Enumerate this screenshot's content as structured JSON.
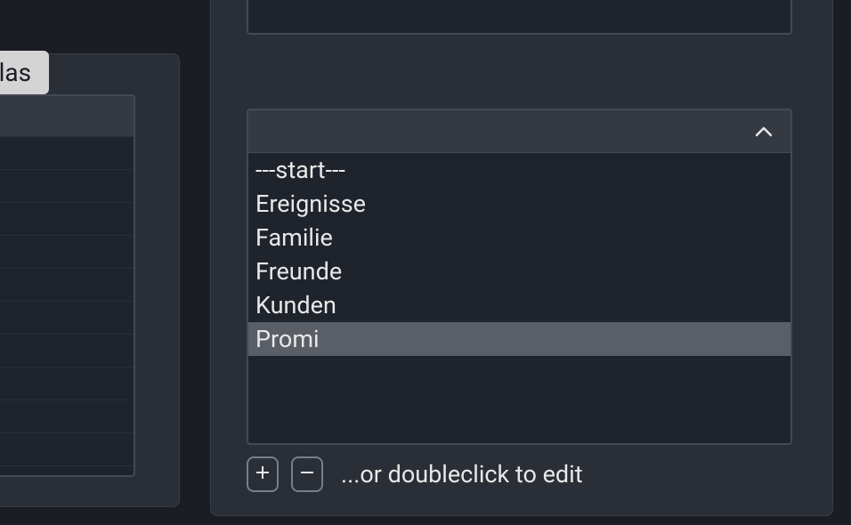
{
  "leftPanel": {
    "tabLabel": "ate atlas"
  },
  "listbox": {
    "items": [
      {
        "label": "---start---",
        "selected": false
      },
      {
        "label": "Ereignisse",
        "selected": false
      },
      {
        "label": "Familie",
        "selected": false
      },
      {
        "label": "Freunde",
        "selected": false
      },
      {
        "label": "Kunden",
        "selected": false
      },
      {
        "label": "Promi",
        "selected": true
      }
    ]
  },
  "controls": {
    "hint": "...or doubleclick to edit"
  }
}
